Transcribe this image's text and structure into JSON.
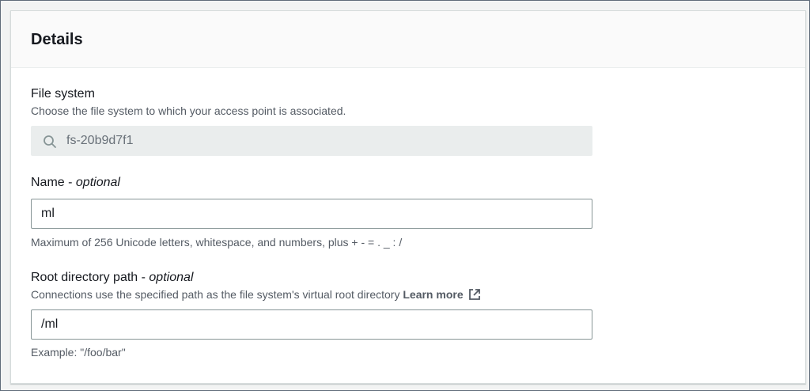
{
  "details": {
    "title": "Details"
  },
  "file_system": {
    "label": "File system",
    "description": "Choose the file system to which your access point is associated.",
    "value": "fs-20b9d7f1",
    "icon": "search-icon"
  },
  "name": {
    "label": "Name - ",
    "optional": "optional",
    "value": "ml",
    "constraint": "Maximum of 256 Unicode letters, whitespace, and numbers, plus + - = . _ : /"
  },
  "root_path": {
    "label": "Root directory path - ",
    "optional": "optional",
    "description": "Connections use the specified path as the file system's virtual root directory ",
    "learn_more": "Learn more",
    "learn_more_icon": "external-link-icon",
    "value": "/ml",
    "example": "Example: \"/foo/bar\""
  }
}
